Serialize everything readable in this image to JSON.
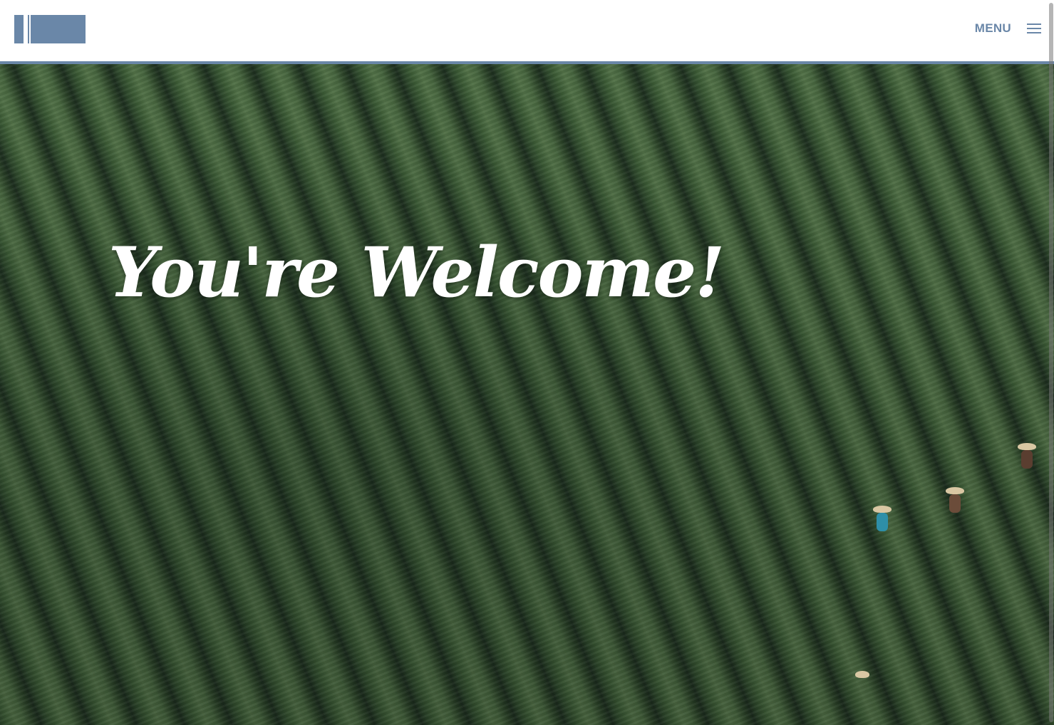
{
  "header": {
    "menu_label": "MENU",
    "menu_icon": "hamburger-menu-icon",
    "accent_color": "#6a87a8"
  },
  "hero": {
    "title": "You're Welcome!",
    "image": "aerial-tea-plantation-with-workers"
  }
}
